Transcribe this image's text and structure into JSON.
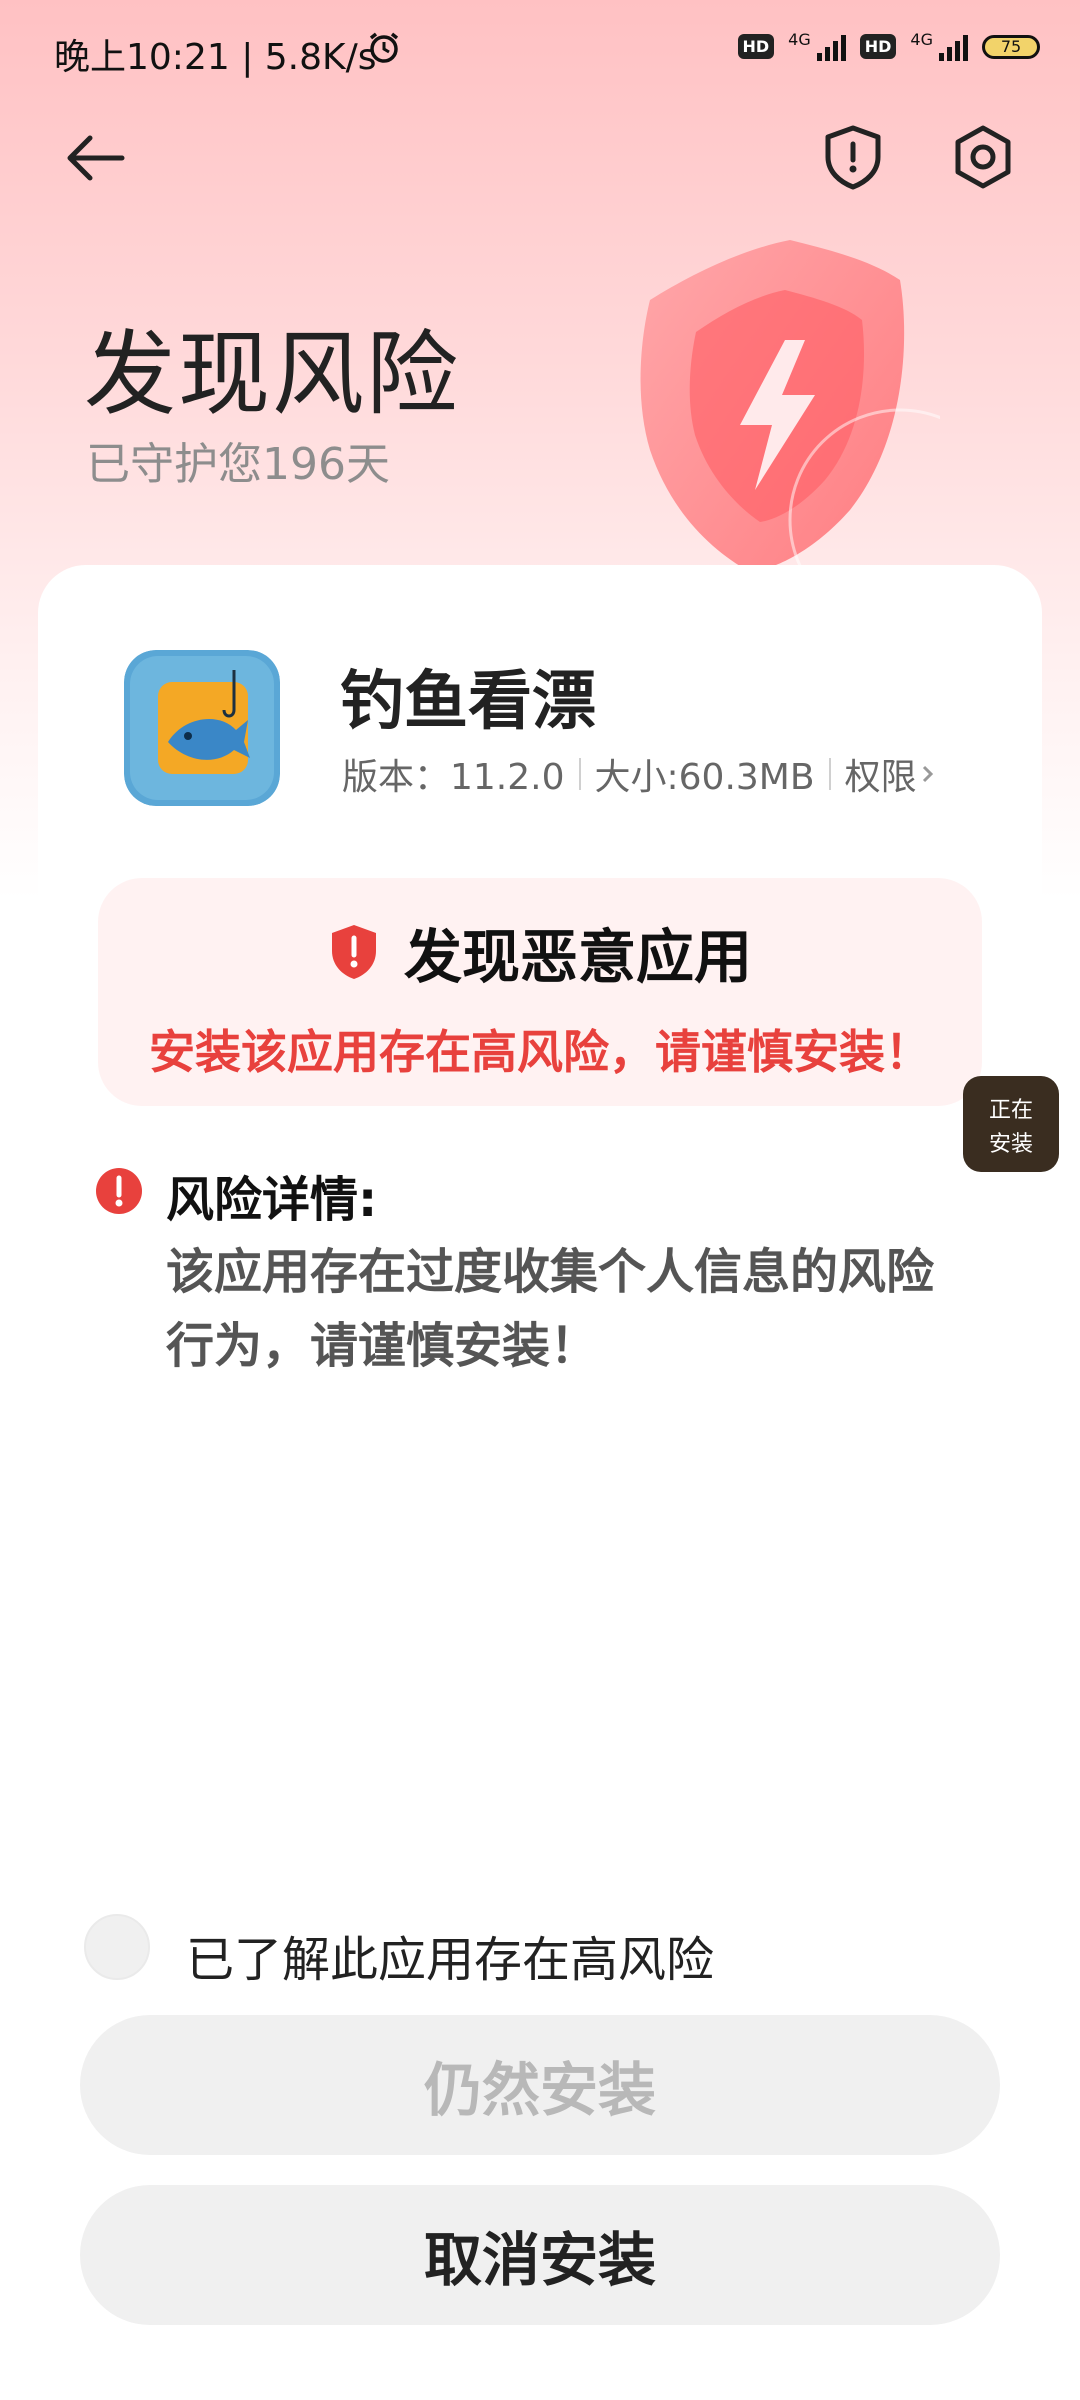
{
  "status_bar": {
    "time": "晚上10:21",
    "speed": "5.8K/s",
    "hd": "HD",
    "network": "4G",
    "battery": "75"
  },
  "header": {
    "title": "发现风险",
    "subtitle": "已守护您196天"
  },
  "app": {
    "name": "钓鱼看漂",
    "version": "版本：11.2.0",
    "size": "大小:60.3MB",
    "permissions": "权限"
  },
  "alert": {
    "title": "发现恶意应用",
    "message": "安装该应用存在高风险，请谨慎安装！"
  },
  "floating": {
    "line1": "正在",
    "line2": "安装"
  },
  "risk_details": {
    "title": "风险详情:",
    "text": "该应用存在过度收集个人信息的风险行为，请谨慎安装！"
  },
  "acknowledge": {
    "label": "已了解此应用存在高风险",
    "checked": false
  },
  "buttons": {
    "install_anyway": "仍然安装",
    "cancel_install": "取消安装"
  },
  "colors": {
    "danger": "#e8413d",
    "alert_bg": "#fff2f2",
    "button_bg": "#f0f0f0"
  },
  "icons": [
    "back-arrow-icon",
    "shield-exclamation-icon",
    "gear-icon",
    "alarm-clock-icon",
    "shield-lightning-icon",
    "danger-shield-icon",
    "info-circle-icon",
    "chevron-right-icon"
  ]
}
